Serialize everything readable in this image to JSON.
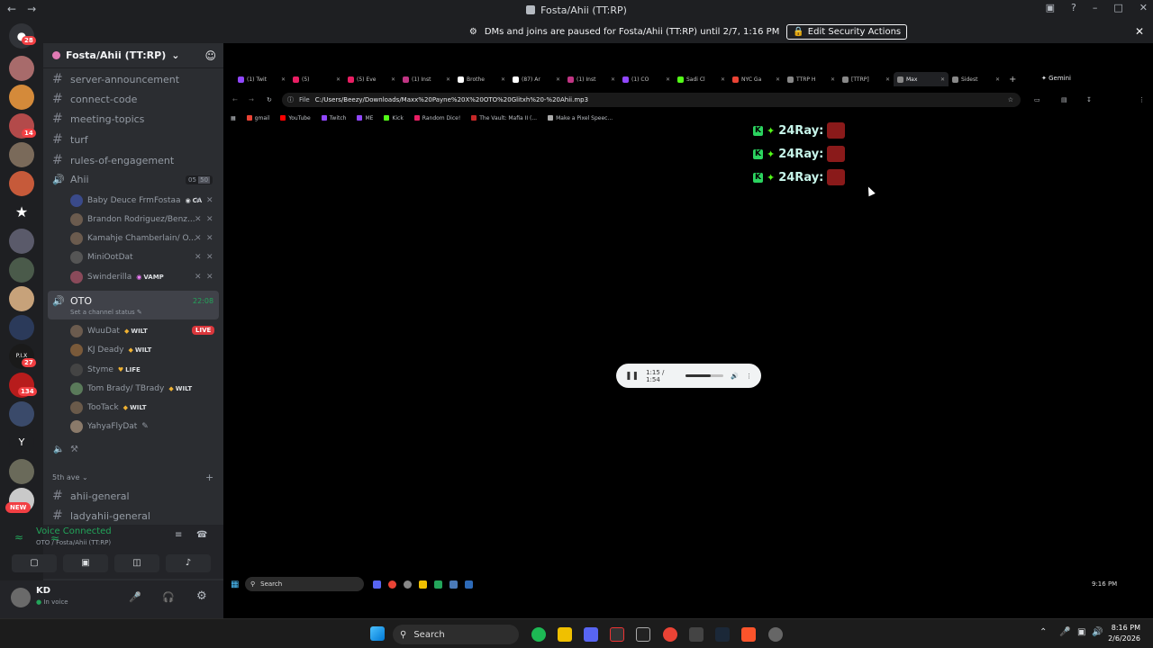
{
  "window": {
    "title": "Fosta/Ahii (TT:RP)"
  },
  "banner": {
    "text": "DMs and joins are paused for Fosta/Ahii (TT:RP) until 2/7, 1:16 PM",
    "button": "Edit Security Actions"
  },
  "rail": {
    "badges": [
      "28",
      "14",
      "27",
      "134"
    ],
    "new_label": "NEW",
    "letter": "Y"
  },
  "server": {
    "name": "Fosta/Ahii (TT:RP)"
  },
  "channels": [
    "server-announcement",
    "connect-code",
    "meeting-topics",
    "turf",
    "rules-of-engagement"
  ],
  "voice_ahii": {
    "name": "Ahii",
    "count_a": "05",
    "count_b": "50",
    "members": [
      {
        "name": "Baby Deuce FrmFostaa",
        "tag": "CA"
      },
      {
        "name": "Brandon Rodriguez/Benz...",
        "tag": ""
      },
      {
        "name": "Kamahje Chamberlain/ O...",
        "tag": ""
      },
      {
        "name": "MiniOotDat",
        "tag": ""
      },
      {
        "name": "Swinderilla",
        "tag": "VAMP"
      }
    ]
  },
  "voice_oto": {
    "name": "OTO",
    "timer": "22:08",
    "status": "Set a channel status",
    "members": [
      {
        "name": "WuuDat",
        "tag": "WILT",
        "live": "LIVE"
      },
      {
        "name": "KJ Deady",
        "tag": "WILT"
      },
      {
        "name": "Styme",
        "tag": "LIFE"
      },
      {
        "name": "Tom Brady/ TBrady",
        "tag": "WILT"
      },
      {
        "name": "TooTack",
        "tag": "WILT"
      },
      {
        "name": "YahyaFlyDat",
        "tag": ""
      }
    ]
  },
  "category": {
    "name": "5th ave",
    "channels": [
      "ahii-general",
      "ladyahii-general"
    ]
  },
  "connection": {
    "status": "Voice Connected",
    "location": "OTO / Fosta/Ahii (TT:RP)"
  },
  "user": {
    "name": "KD",
    "status": "In voice"
  },
  "browser": {
    "tabs": [
      "(1) Twit",
      "(5)",
      "(5) Eve",
      "(1) Inst",
      "Brothe",
      "(87) Ar",
      "(1) Inst",
      "(1) CO",
      "Sadi Cl",
      "NYC Ga",
      "TTRP H",
      "[TTRP]",
      "Max",
      "Sidest"
    ],
    "tab_colors": [
      "#9147ff",
      "#e91e63",
      "#e91e63",
      "#c13584",
      "#ffffff",
      "#ffffff",
      "#c13584",
      "#9147ff",
      "#53fc18",
      "#ea4335",
      "#888888",
      "#888888",
      "#888888",
      "#888888"
    ],
    "gemini": "Gemini",
    "url_prefix": "File",
    "url": "C:/Users/Beezy/Downloads/Maxx%20Payne%20X%20OTO%20Glitxh%20-%20Ahii.mp3",
    "bookmarks": [
      "gmail",
      "YouTube",
      "Twitch",
      "ME",
      "Kick",
      "Random Dice!",
      "The Vault: Mafia II (...",
      "Make a Pixel Speec..."
    ],
    "bookmark_colors": [
      "#ea4335",
      "#ff0000",
      "#9147ff",
      "#9147ff",
      "#53fc18",
      "#e91e63",
      "#c62828",
      "#aaaaaa"
    ]
  },
  "chat_lines": [
    {
      "user": "24Ray:"
    },
    {
      "user": "24Ray:"
    },
    {
      "user": "24Ray:"
    }
  ],
  "player": {
    "time": "1:15 / 1:54",
    "progress": 0.65
  },
  "inner_taskbar": {
    "search": "Search",
    "time": "9:16 PM"
  },
  "taskbar": {
    "search": "Search",
    "time": "8:16 PM",
    "date": "2/6/2026"
  }
}
